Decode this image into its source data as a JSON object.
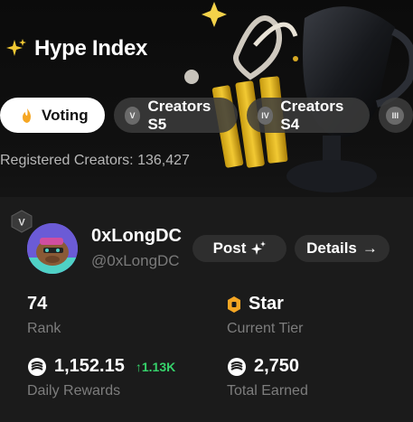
{
  "header": {
    "title": "Hype Index",
    "title_icon": "sparkle-icon"
  },
  "tabs": [
    {
      "label": "Voting",
      "icon": "fire-icon",
      "active": true
    },
    {
      "label": "Creators S5",
      "badge": "V",
      "active": false
    },
    {
      "label": "Creators S4",
      "badge": "IV",
      "active": false
    },
    {
      "label": "",
      "badge": "III",
      "active": false
    }
  ],
  "registered": {
    "text": "Registered Creators: 136,427"
  },
  "creator": {
    "season_badge": "V",
    "name": "0xLongDC",
    "handle": "@0xLongDC",
    "post_label": "Post",
    "details_label": "Details",
    "details_arrow": "→"
  },
  "stats": {
    "rank_value": "74",
    "rank_label": "Rank",
    "tier_value": "Star",
    "tier_label": "Current Tier",
    "daily_value": "1,152.15",
    "daily_delta": "↑1.13K",
    "daily_label": "Daily Rewards",
    "total_value": "2,750",
    "total_label": "Total Earned"
  },
  "colors": {
    "background": "#000000",
    "card": "#1b1b1b",
    "accent_green": "#36d36b",
    "tier_gold": "#f5a623",
    "muted": "#7d7d7d"
  }
}
